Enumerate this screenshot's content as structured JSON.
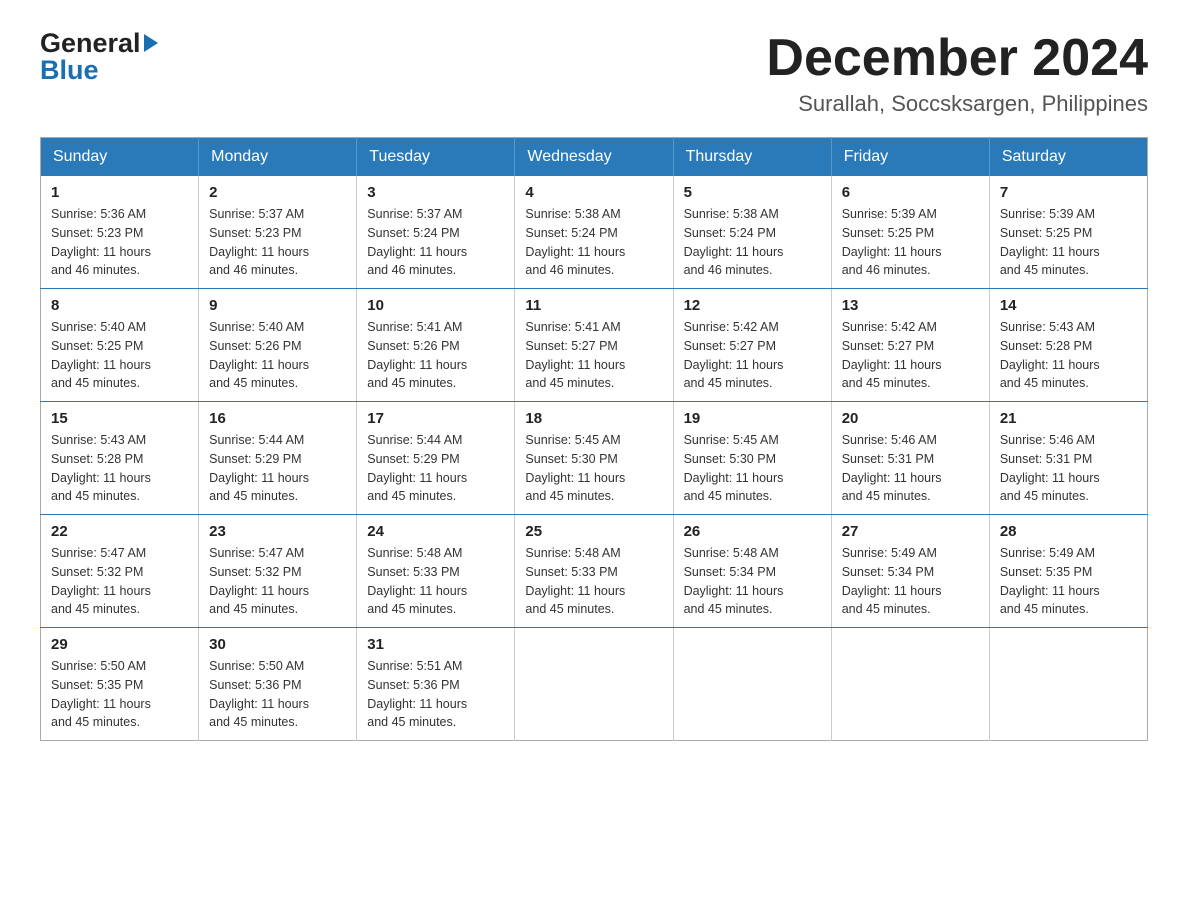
{
  "logo": {
    "general": "General",
    "blue": "Blue",
    "alt": "GeneralBlue logo"
  },
  "header": {
    "month_year": "December 2024",
    "location": "Surallah, Soccsksargen, Philippines"
  },
  "weekdays": [
    "Sunday",
    "Monday",
    "Tuesday",
    "Wednesday",
    "Thursday",
    "Friday",
    "Saturday"
  ],
  "weeks": [
    [
      {
        "day": "1",
        "info": "Sunrise: 5:36 AM\nSunset: 5:23 PM\nDaylight: 11 hours\nand 46 minutes."
      },
      {
        "day": "2",
        "info": "Sunrise: 5:37 AM\nSunset: 5:23 PM\nDaylight: 11 hours\nand 46 minutes."
      },
      {
        "day": "3",
        "info": "Sunrise: 5:37 AM\nSunset: 5:24 PM\nDaylight: 11 hours\nand 46 minutes."
      },
      {
        "day": "4",
        "info": "Sunrise: 5:38 AM\nSunset: 5:24 PM\nDaylight: 11 hours\nand 46 minutes."
      },
      {
        "day": "5",
        "info": "Sunrise: 5:38 AM\nSunset: 5:24 PM\nDaylight: 11 hours\nand 46 minutes."
      },
      {
        "day": "6",
        "info": "Sunrise: 5:39 AM\nSunset: 5:25 PM\nDaylight: 11 hours\nand 46 minutes."
      },
      {
        "day": "7",
        "info": "Sunrise: 5:39 AM\nSunset: 5:25 PM\nDaylight: 11 hours\nand 45 minutes."
      }
    ],
    [
      {
        "day": "8",
        "info": "Sunrise: 5:40 AM\nSunset: 5:25 PM\nDaylight: 11 hours\nand 45 minutes."
      },
      {
        "day": "9",
        "info": "Sunrise: 5:40 AM\nSunset: 5:26 PM\nDaylight: 11 hours\nand 45 minutes."
      },
      {
        "day": "10",
        "info": "Sunrise: 5:41 AM\nSunset: 5:26 PM\nDaylight: 11 hours\nand 45 minutes."
      },
      {
        "day": "11",
        "info": "Sunrise: 5:41 AM\nSunset: 5:27 PM\nDaylight: 11 hours\nand 45 minutes."
      },
      {
        "day": "12",
        "info": "Sunrise: 5:42 AM\nSunset: 5:27 PM\nDaylight: 11 hours\nand 45 minutes."
      },
      {
        "day": "13",
        "info": "Sunrise: 5:42 AM\nSunset: 5:27 PM\nDaylight: 11 hours\nand 45 minutes."
      },
      {
        "day": "14",
        "info": "Sunrise: 5:43 AM\nSunset: 5:28 PM\nDaylight: 11 hours\nand 45 minutes."
      }
    ],
    [
      {
        "day": "15",
        "info": "Sunrise: 5:43 AM\nSunset: 5:28 PM\nDaylight: 11 hours\nand 45 minutes."
      },
      {
        "day": "16",
        "info": "Sunrise: 5:44 AM\nSunset: 5:29 PM\nDaylight: 11 hours\nand 45 minutes."
      },
      {
        "day": "17",
        "info": "Sunrise: 5:44 AM\nSunset: 5:29 PM\nDaylight: 11 hours\nand 45 minutes."
      },
      {
        "day": "18",
        "info": "Sunrise: 5:45 AM\nSunset: 5:30 PM\nDaylight: 11 hours\nand 45 minutes."
      },
      {
        "day": "19",
        "info": "Sunrise: 5:45 AM\nSunset: 5:30 PM\nDaylight: 11 hours\nand 45 minutes."
      },
      {
        "day": "20",
        "info": "Sunrise: 5:46 AM\nSunset: 5:31 PM\nDaylight: 11 hours\nand 45 minutes."
      },
      {
        "day": "21",
        "info": "Sunrise: 5:46 AM\nSunset: 5:31 PM\nDaylight: 11 hours\nand 45 minutes."
      }
    ],
    [
      {
        "day": "22",
        "info": "Sunrise: 5:47 AM\nSunset: 5:32 PM\nDaylight: 11 hours\nand 45 minutes."
      },
      {
        "day": "23",
        "info": "Sunrise: 5:47 AM\nSunset: 5:32 PM\nDaylight: 11 hours\nand 45 minutes."
      },
      {
        "day": "24",
        "info": "Sunrise: 5:48 AM\nSunset: 5:33 PM\nDaylight: 11 hours\nand 45 minutes."
      },
      {
        "day": "25",
        "info": "Sunrise: 5:48 AM\nSunset: 5:33 PM\nDaylight: 11 hours\nand 45 minutes."
      },
      {
        "day": "26",
        "info": "Sunrise: 5:48 AM\nSunset: 5:34 PM\nDaylight: 11 hours\nand 45 minutes."
      },
      {
        "day": "27",
        "info": "Sunrise: 5:49 AM\nSunset: 5:34 PM\nDaylight: 11 hours\nand 45 minutes."
      },
      {
        "day": "28",
        "info": "Sunrise: 5:49 AM\nSunset: 5:35 PM\nDaylight: 11 hours\nand 45 minutes."
      }
    ],
    [
      {
        "day": "29",
        "info": "Sunrise: 5:50 AM\nSunset: 5:35 PM\nDaylight: 11 hours\nand 45 minutes."
      },
      {
        "day": "30",
        "info": "Sunrise: 5:50 AM\nSunset: 5:36 PM\nDaylight: 11 hours\nand 45 minutes."
      },
      {
        "day": "31",
        "info": "Sunrise: 5:51 AM\nSunset: 5:36 PM\nDaylight: 11 hours\nand 45 minutes."
      },
      {
        "day": "",
        "info": ""
      },
      {
        "day": "",
        "info": ""
      },
      {
        "day": "",
        "info": ""
      },
      {
        "day": "",
        "info": ""
      }
    ]
  ]
}
